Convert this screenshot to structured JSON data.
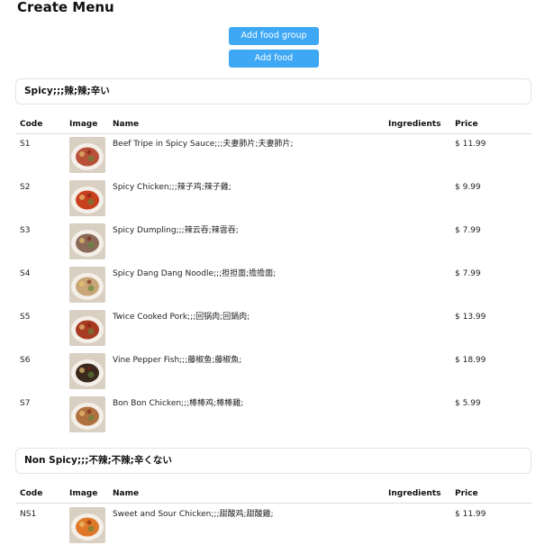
{
  "page": {
    "title": "Create Menu"
  },
  "toolbar": {
    "add_group_label": "Add food group",
    "add_food_label": "Add food"
  },
  "columns": {
    "code": "Code",
    "image": "Image",
    "name": "Name",
    "ingredients": "Ingredients",
    "price": "Price"
  },
  "groups": [
    {
      "title": "Spicy;;;辣;辣;辛い",
      "items": [
        {
          "code": "S1",
          "name": "Beef Tripe in Spicy Sauce;;;夫妻肺片;夫妻肺片;",
          "ingredients": "",
          "price": "$ 11.99",
          "image_color": "#b8503a"
        },
        {
          "code": "S2",
          "name": "Spicy Chicken;;;辣子鸡;辣子雞;",
          "ingredients": "",
          "price": "$ 9.99",
          "image_color": "#c8401e"
        },
        {
          "code": "S3",
          "name": "Spicy Dumpling;;;辣云吞;辣雲吞;",
          "ingredients": "",
          "price": "$ 7.99",
          "image_color": "#8a6a58"
        },
        {
          "code": "S4",
          "name": "Spicy Dang Dang Noodle;;;担担面;擔擔面;",
          "ingredients": "",
          "price": "$ 7.99",
          "image_color": "#c9a678"
        },
        {
          "code": "S5",
          "name": "Twice Cooked Pork;;;回锅肉;回鍋肉;",
          "ingredients": "",
          "price": "$ 13.99",
          "image_color": "#a83a22"
        },
        {
          "code": "S6",
          "name": "Vine Pepper Fish;;;藤椒鱼;藤椒魚;",
          "ingredients": "",
          "price": "$ 18.99",
          "image_color": "#3a2a1e"
        },
        {
          "code": "S7",
          "name": "Bon Bon Chicken;;;棒棒鸡;棒棒雞;",
          "ingredients": "",
          "price": "$ 5.99",
          "image_color": "#b07040"
        }
      ]
    },
    {
      "title": "Non Spicy;;;不辣;不辣;辛くない",
      "items": [
        {
          "code": "NS1",
          "name": "Sweet and Sour Chicken;;;甜酸鸡;甜酸雞;",
          "ingredients": "",
          "price": "$ 11.99",
          "image_color": "#e0782a"
        }
      ]
    }
  ]
}
